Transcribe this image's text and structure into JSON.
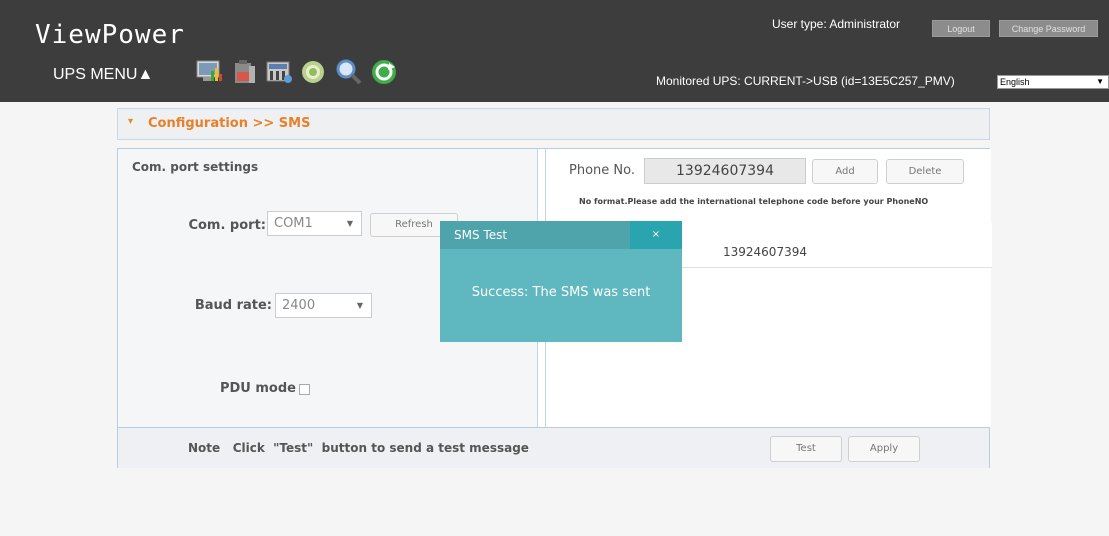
{
  "header": {
    "logo": "ViewPower",
    "user_type": "User type: Administrator",
    "logout_label": "Logout",
    "change_password_label": "Change Password",
    "ups_menu": "UPS MENU▲",
    "monitored": "Monitored UPS: CURRENT->USB (id=13E5C257_PMV)",
    "language": "English",
    "toolbar_icons": [
      "monitor-chart-icon",
      "battery-icon",
      "settings-tools-icon",
      "status-ring-icon",
      "search-magnifier-icon",
      "refresh-icon"
    ]
  },
  "config_bar": {
    "title": "Configuration >> SMS"
  },
  "com_settings": {
    "heading": "Com. port settings",
    "com_port_label": "Com. port:",
    "com_port_value": "COM1",
    "refresh_label": "Refresh",
    "baud_rate_label": "Baud rate:",
    "baud_rate_value": "2400",
    "pdu_mode_label": "PDU mode"
  },
  "phone": {
    "label": "Phone No.",
    "value": "13924607394",
    "add_label": "Add",
    "delete_label": "Delete",
    "format_note": "No format.Please add the international telephone code before your PhoneNO",
    "list": [
      "13924607394"
    ]
  },
  "footer": {
    "note": "Note   Click  \"Test\"  button to send a test message",
    "test_label": "Test",
    "apply_label": "Apply"
  },
  "dialog": {
    "title": "SMS Test",
    "close": "×",
    "message": "Success: The SMS was sent"
  },
  "colors": {
    "header_bg": "#3d3d3d",
    "accent_orange": "#e8802a",
    "dialog_bg": "#5fb8bf",
    "dialog_close_bg": "#2aa4ae"
  }
}
